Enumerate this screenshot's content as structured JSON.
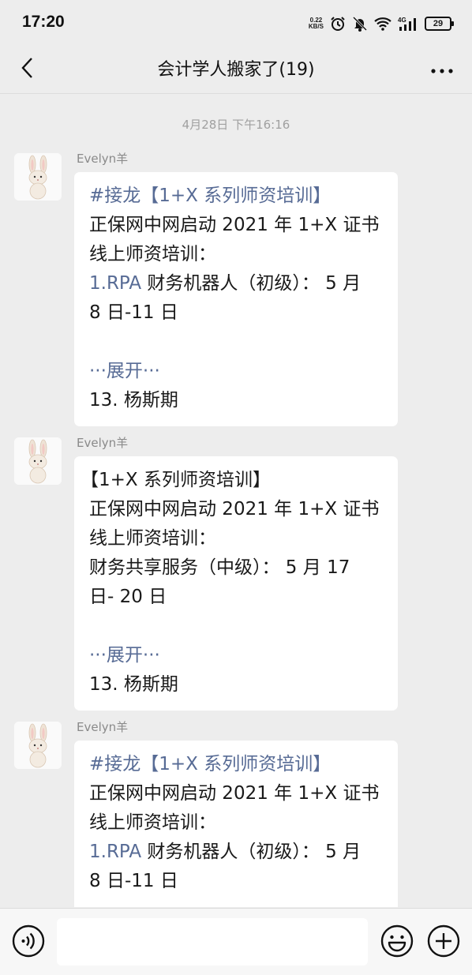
{
  "status": {
    "time": "17:20",
    "net_speed_value": "0.22",
    "net_speed_unit": "KB/S",
    "network_type": "4G",
    "battery": "29"
  },
  "nav": {
    "title": "会计学人搬家了(19)",
    "back_icon": "chevron-left-icon",
    "more_icon": "more-dots-icon"
  },
  "chat": {
    "timestamp": "4月28日 下午16:16",
    "messages": [
      {
        "sender": "Evelyn羊",
        "l1_tag": "#接龙【1+X 系列师资培训】",
        "l2": "正保网中网启动 2021 年 1+X 证书",
        "l3": "线上师资培训：",
        "l4_link": "1.RPA",
        "l4_rest": " 财务机器人（初级）： 5 月",
        "l5": "8 日-11 日",
        "expand": "···展开···",
        "l7": "13. 杨斯期"
      },
      {
        "sender": "Evelyn羊",
        "l1": "【1+X 系列师资培训】",
        "l2": "正保网中网启动 2021 年 1+X 证书",
        "l3": "线上师资培训：",
        "l4": "财务共享服务（中级）： 5 月 17",
        "l5": "日- 20 日",
        "expand": "···展开···",
        "l7": "13. 杨斯期"
      },
      {
        "sender": "Evelyn羊",
        "l1_tag": "#接龙【1+X 系列师资培训】",
        "l2": "正保网中网启动 2021 年 1+X 证书",
        "l3": "线上师资培训：",
        "l4_link": "1.RPA",
        "l4_rest": " 财务机器人（初级）： 5 月",
        "l5": "8 日-11 日"
      }
    ]
  },
  "input_bar": {
    "voice_icon": "voice-icon",
    "emoji_icon": "emoji-icon",
    "plus_icon": "plus-icon",
    "message_value": ""
  },
  "colors": {
    "background": "#ededed",
    "bubble": "#ffffff",
    "link": "#576b95"
  }
}
